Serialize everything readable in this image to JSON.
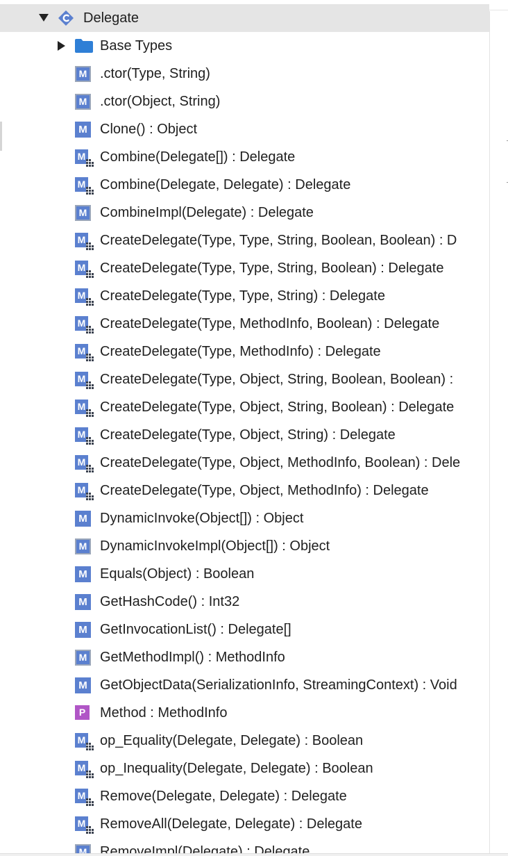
{
  "tree": {
    "root": {
      "label": "Delegate",
      "icon": "csharp-class-icon",
      "expanded": true
    },
    "children": [
      {
        "label": "Base Types",
        "kind": "folder",
        "icon": "folder-icon",
        "collapsed": true
      },
      {
        "label": ".ctor(Type, String)",
        "kind": "method-protected",
        "icon": "method-icon"
      },
      {
        "label": ".ctor(Object, String)",
        "kind": "method-protected",
        "icon": "method-icon"
      },
      {
        "label": "Clone() : Object",
        "kind": "method",
        "icon": "method-icon"
      },
      {
        "label": "Combine(Delegate[]) : Delegate",
        "kind": "method-static",
        "icon": "static-method-icon"
      },
      {
        "label": "Combine(Delegate, Delegate) : Delegate",
        "kind": "method-static",
        "icon": "static-method-icon"
      },
      {
        "label": "CombineImpl(Delegate) : Delegate",
        "kind": "method-protected",
        "icon": "method-icon"
      },
      {
        "label": "CreateDelegate(Type, Type, String, Boolean, Boolean) : D",
        "kind": "method-static",
        "icon": "static-method-icon"
      },
      {
        "label": "CreateDelegate(Type, Type, String, Boolean) : Delegate",
        "kind": "method-static",
        "icon": "static-method-icon"
      },
      {
        "label": "CreateDelegate(Type, Type, String) : Delegate",
        "kind": "method-static",
        "icon": "static-method-icon"
      },
      {
        "label": "CreateDelegate(Type, MethodInfo, Boolean) : Delegate",
        "kind": "method-static",
        "icon": "static-method-icon"
      },
      {
        "label": "CreateDelegate(Type, MethodInfo) : Delegate",
        "kind": "method-static",
        "icon": "static-method-icon"
      },
      {
        "label": "CreateDelegate(Type, Object, String, Boolean, Boolean) :",
        "kind": "method-static",
        "icon": "static-method-icon"
      },
      {
        "label": "CreateDelegate(Type, Object, String, Boolean) : Delegate",
        "kind": "method-static",
        "icon": "static-method-icon"
      },
      {
        "label": "CreateDelegate(Type, Object, String) : Delegate",
        "kind": "method-static",
        "icon": "static-method-icon"
      },
      {
        "label": "CreateDelegate(Type, Object, MethodInfo, Boolean) : Dele",
        "kind": "method-static",
        "icon": "static-method-icon"
      },
      {
        "label": "CreateDelegate(Type, Object, MethodInfo) : Delegate",
        "kind": "method-static",
        "icon": "static-method-icon"
      },
      {
        "label": "DynamicInvoke(Object[]) : Object",
        "kind": "method",
        "icon": "method-icon"
      },
      {
        "label": "DynamicInvokeImpl(Object[]) : Object",
        "kind": "method-protected",
        "icon": "method-icon"
      },
      {
        "label": "Equals(Object) : Boolean",
        "kind": "method",
        "icon": "method-icon"
      },
      {
        "label": "GetHashCode() : Int32",
        "kind": "method",
        "icon": "method-icon"
      },
      {
        "label": "GetInvocationList() : Delegate[]",
        "kind": "method",
        "icon": "method-icon"
      },
      {
        "label": "GetMethodImpl() : MethodInfo",
        "kind": "method-protected",
        "icon": "method-icon"
      },
      {
        "label": "GetObjectData(SerializationInfo, StreamingContext) : Void",
        "kind": "method",
        "icon": "method-icon"
      },
      {
        "label": "Method : MethodInfo",
        "kind": "property",
        "icon": "property-icon"
      },
      {
        "label": "op_Equality(Delegate, Delegate) : Boolean",
        "kind": "method-static",
        "icon": "static-method-icon"
      },
      {
        "label": "op_Inequality(Delegate, Delegate) : Boolean",
        "kind": "method-static",
        "icon": "static-method-icon"
      },
      {
        "label": "Remove(Delegate, Delegate) : Delegate",
        "kind": "method-static",
        "icon": "static-method-icon"
      },
      {
        "label": "RemoveAll(Delegate, Delegate) : Delegate",
        "kind": "method-static",
        "icon": "static-method-icon"
      },
      {
        "label": "RemoveImpl(Delegate) : Delegate",
        "kind": "method-protected",
        "icon": "method-icon"
      }
    ]
  },
  "colors": {
    "method_badge": "#5b80cf",
    "property_badge": "#b056c6",
    "class_icon": "#5b80cf",
    "folder": "#2f7fd6",
    "selected_row": "#e5e5e5"
  }
}
